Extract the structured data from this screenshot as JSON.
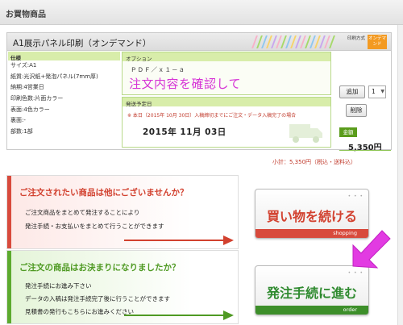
{
  "header": {
    "title": "お買物商品"
  },
  "product": {
    "title": "A1展示パネル印刷（オンデマンド）",
    "badge_a": "印刷方式",
    "badge_b": "オンデマンド",
    "specs_header": "仕様",
    "specs": [
      "サイズ:A1",
      "紙質:光沢紙+発泡パネル(7mm厚)",
      "納期:4営業日",
      "印刷色数:片面カラー",
      "表面:4色カラー",
      "裏面:-",
      "部数:1部"
    ],
    "option_header": "オプション",
    "option_text": "ＰＤＦ／ｘ１－ａ",
    "overlay_text": "注文内容を確認して",
    "ship_header": "発送予定日",
    "ship_note": "※ 本日（2015年 10月 30日）入稿締切までにご注文・データ入稿完了の場合",
    "ship_date": "2015年 11月 03日",
    "add_label": "追加",
    "quantity": "1",
    "delete_label": "削除",
    "amount_label": "金額",
    "amount": "5,350円"
  },
  "subtotal": "小計：5,350円（税込・送料込）",
  "panels": {
    "continue": {
      "title": "ご注文されたい商品は他にございませんか？",
      "lines": [
        "ご注文商品をまとめて発注することにより",
        "発注手続・お支払いをまとめて行うことができます"
      ]
    },
    "decided": {
      "title": "ご注文の商品はお決まりになりましたか？",
      "lines": [
        "発注手続にお進み下さい",
        "データの入稿は発注手続完了後に行うことができます",
        "見積書の発行もこちらにお進みください"
      ]
    }
  },
  "buttons": {
    "shopping_label": "買い物を続ける",
    "shopping_sub": "shopping",
    "order_label": "発注手続に進む",
    "order_sub": "order"
  },
  "colors": {
    "accent_red": "#d2412f",
    "accent_green": "#4f9a23",
    "highlight_magenta": "#e23be2"
  }
}
